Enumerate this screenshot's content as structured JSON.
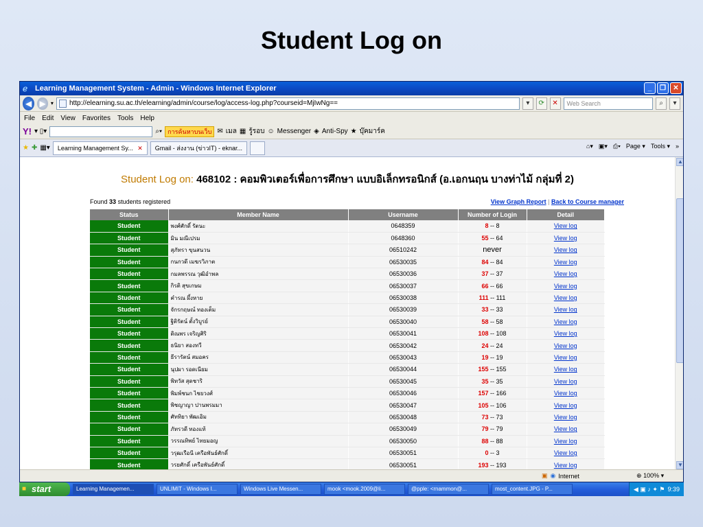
{
  "slide": {
    "title": "Student Log on"
  },
  "window": {
    "title": "Learning Management System - Admin - Windows Internet Explorer",
    "url": "http://elearning.su.ac.th/elearning/admin/course/log/access-log.php?courseid=MjIwNg==",
    "search_placeholder": "Web Search",
    "menu": [
      "File",
      "Edit",
      "View",
      "Favorites",
      "Tools",
      "Help"
    ],
    "toolbar": {
      "search_btn": "การค้นหาบนเว็บ",
      "mail": "เมล",
      "news": "รู้รอบ",
      "messenger": "Messenger",
      "antispy": "Anti-Spy",
      "bookmarks": "บุ๊คมาร์ค"
    },
    "tabs": [
      "Learning Management Sy...",
      "Gmail - ส่งงาน (ข่าวIT) - eknar..."
    ],
    "tab_right": {
      "page": "Page",
      "tools": "Tools"
    },
    "status": {
      "zone": "Internet",
      "zoom": "100%"
    }
  },
  "page": {
    "heading_prefix": "Student Log on:",
    "heading_course": "468102 : คอมพิวเตอร์เพื่อการศึกษา แบบอิเล็กทรอนิกส์ (อ.เอกนฤน บางท่าไม้ กลุ่มที่ 2)",
    "found_prefix": "Found",
    "found_count": "33",
    "found_suffix": "students registered",
    "link_graph": "View Graph Report",
    "link_sep": "|",
    "link_back": "Back to Course manager",
    "columns": [
      "Status",
      "Member Name",
      "Username",
      "Number of Login",
      "Detail"
    ],
    "rows": [
      {
        "status": "Student",
        "name": "พงศ์ศักดิ์ รัตนะ",
        "username": "0648359",
        "login_hi": "8",
        "login_total": "8",
        "detail": "View log"
      },
      {
        "status": "Student",
        "name": "มิน มณีเปรม",
        "username": "0648360",
        "login_hi": "55",
        "login_total": "64",
        "detail": "View log"
      },
      {
        "status": "Student",
        "name": "สุภัทรา ขุนสนวน",
        "username": "06510242",
        "login_hi": "",
        "login_total": "never",
        "detail": "View log"
      },
      {
        "status": "Student",
        "name": "กนกวดี เมฆรวิภาต",
        "username": "06530035",
        "login_hi": "84",
        "login_total": "84",
        "detail": "View log"
      },
      {
        "status": "Student",
        "name": "กมลพรรณ วุฒิอำพล",
        "username": "06530036",
        "login_hi": "37",
        "login_total": "37",
        "detail": "View log"
      },
      {
        "status": "Student",
        "name": "กิรติ สุขเกษม",
        "username": "06530037",
        "login_hi": "66",
        "login_total": "66",
        "detail": "View log"
      },
      {
        "status": "Student",
        "name": "คำรณ ผึ้งหาย",
        "username": "06530038",
        "login_hi": "111",
        "login_total": "111",
        "detail": "View log"
      },
      {
        "status": "Student",
        "name": "จักรกฤษณ์ ทองเต็ม",
        "username": "06530039",
        "login_hi": "33",
        "login_total": "33",
        "detail": "View log"
      },
      {
        "status": "Student",
        "name": "ฐิติรัตน์ ตั้งวิบูรย์",
        "username": "06530040",
        "login_hi": "58",
        "login_total": "58",
        "detail": "View log"
      },
      {
        "status": "Student",
        "name": "ดิณพร เจริญศิริ",
        "username": "06530041",
        "login_hi": "108",
        "login_total": "108",
        "detail": "View log"
      },
      {
        "status": "Student",
        "name": "ธนิยา สองทวี",
        "username": "06530042",
        "login_hi": "24",
        "login_total": "24",
        "detail": "View log"
      },
      {
        "status": "Student",
        "name": "ธีรารัตน์ สมอคร",
        "username": "06530043",
        "login_hi": "19",
        "login_total": "19",
        "detail": "View log"
      },
      {
        "status": "Student",
        "name": "นุปผา รอดเนียม",
        "username": "06530044",
        "login_hi": "155",
        "login_total": "155",
        "detail": "View log"
      },
      {
        "status": "Student",
        "name": "พิทวัส สุดชาริ",
        "username": "06530045",
        "login_hi": "35",
        "login_total": "35",
        "detail": "View log"
      },
      {
        "status": "Student",
        "name": "พิมพ์ชนก ไชยวงศ์",
        "username": "06530046",
        "login_hi": "157",
        "login_total": "166",
        "detail": "View log"
      },
      {
        "status": "Student",
        "name": "พิชญาญา ปานพรมมา",
        "username": "06530047",
        "login_hi": "105",
        "login_total": "106",
        "detail": "View log"
      },
      {
        "status": "Student",
        "name": "ศัททิยา พัฒเอิม",
        "username": "06530048",
        "login_hi": "73",
        "login_total": "73",
        "detail": "View log"
      },
      {
        "status": "Student",
        "name": "ภัทรวดี ทองแท้",
        "username": "06530049",
        "login_hi": "79",
        "login_total": "79",
        "detail": "View log"
      },
      {
        "status": "Student",
        "name": "วรรณทิพย์ ไทยมอญ",
        "username": "06530050",
        "login_hi": "88",
        "login_total": "88",
        "detail": "View log"
      },
      {
        "status": "Student",
        "name": "วรุฒเรือนี เครือพันธ์ศักดิ์",
        "username": "06530051",
        "login_hi": "0",
        "login_total": "3",
        "detail": "View log"
      },
      {
        "status": "Student",
        "name": "วรยศักดิ์ เครือพันธ์ศักดิ์",
        "username": "06530051",
        "login_hi": "193",
        "login_total": "193",
        "detail": "View log"
      }
    ]
  },
  "taskbar": {
    "start": "start",
    "tasks": [
      "Learning Managemen...",
      "UNLIMIT - Windows I...",
      "Windows Live Messen...",
      "mook <mook.2009@li...",
      "@pple: <rnammon@...",
      "most_content.JPG - P..."
    ],
    "clock": "9:39"
  },
  "colors": {
    "status_green": "#0a7a0a",
    "header_gray": "#808080",
    "login_red": "#dd0000",
    "heading_orange": "#c07a00"
  }
}
